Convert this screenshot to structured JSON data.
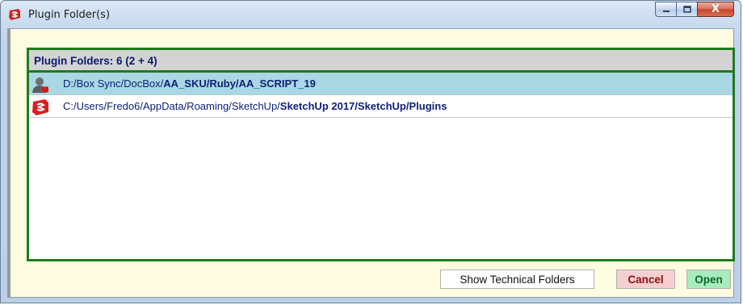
{
  "window": {
    "title": "Plugin Folder(s)",
    "app_icon": "sketchup-icon",
    "controls": {
      "minimize": "minimize-icon",
      "maximize": "maximize-icon",
      "close_label": "X"
    }
  },
  "panel": {
    "title": "Plugin Folders: 6 (2 + 4)",
    "rows": [
      {
        "icon": "user-plugin-icon",
        "selected": true,
        "prefix": "D:/Box Sync/DocBox/",
        "suffix": "AA_SKU/Ruby/AA_SCRIPT_19"
      },
      {
        "icon": "sketchup-icon",
        "selected": false,
        "prefix": "C:/Users/Fredo6/AppData/Roaming/SketchUp/",
        "suffix": "SketchUp 2017/SketchUp/Plugins"
      }
    ]
  },
  "buttons": {
    "technical": "Show Technical Folders",
    "cancel": "Cancel",
    "open": "Open"
  },
  "colors": {
    "panel_border": "#1f7a1f",
    "selected_row": "#a9d7e4",
    "cancel_bg": "#f6d0d0",
    "open_bg": "#a8ecbe",
    "client_bg": "#fdfbe0"
  }
}
